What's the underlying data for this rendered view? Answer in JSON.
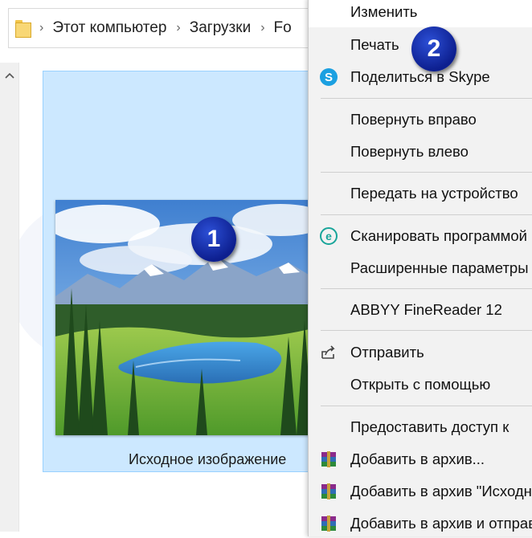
{
  "address_bar": {
    "crumbs": [
      "Этот компьютер",
      "Загрузки",
      "Fo"
    ]
  },
  "file": {
    "caption": "Исходное изображение"
  },
  "context_menu": {
    "items": [
      {
        "label": "Изменить",
        "icon": "none"
      },
      {
        "label": "Печать",
        "icon": "none"
      },
      {
        "label": "Поделиться в Skype",
        "icon": "skype-icon"
      },
      {
        "label": "Повернуть вправо",
        "icon": "none"
      },
      {
        "label": "Повернуть влево",
        "icon": "none"
      },
      {
        "label": "Передать на устройство",
        "icon": "none"
      },
      {
        "label": "Сканировать программой",
        "icon": "eset-scan-icon"
      },
      {
        "label": "Расширенные параметры",
        "icon": "none"
      },
      {
        "label": "ABBYY FineReader 12",
        "icon": "none"
      },
      {
        "label": "Отправить",
        "icon": "share-icon"
      },
      {
        "label": "Открыть с помощью",
        "icon": "none"
      },
      {
        "label": "Предоставить доступ к",
        "icon": "none"
      },
      {
        "label": "Добавить в архив...",
        "icon": "winrar-icon"
      },
      {
        "label": "Добавить в архив \"Исходн",
        "icon": "winrar-icon"
      },
      {
        "label": "Добавить в архив и отправ",
        "icon": "winrar-icon"
      }
    ]
  },
  "badges": {
    "first": "1",
    "second": "2"
  },
  "colors": {
    "selection": "#cce8ff",
    "badge": "#1a35b8",
    "menu_bg": "#f2f2f2"
  }
}
